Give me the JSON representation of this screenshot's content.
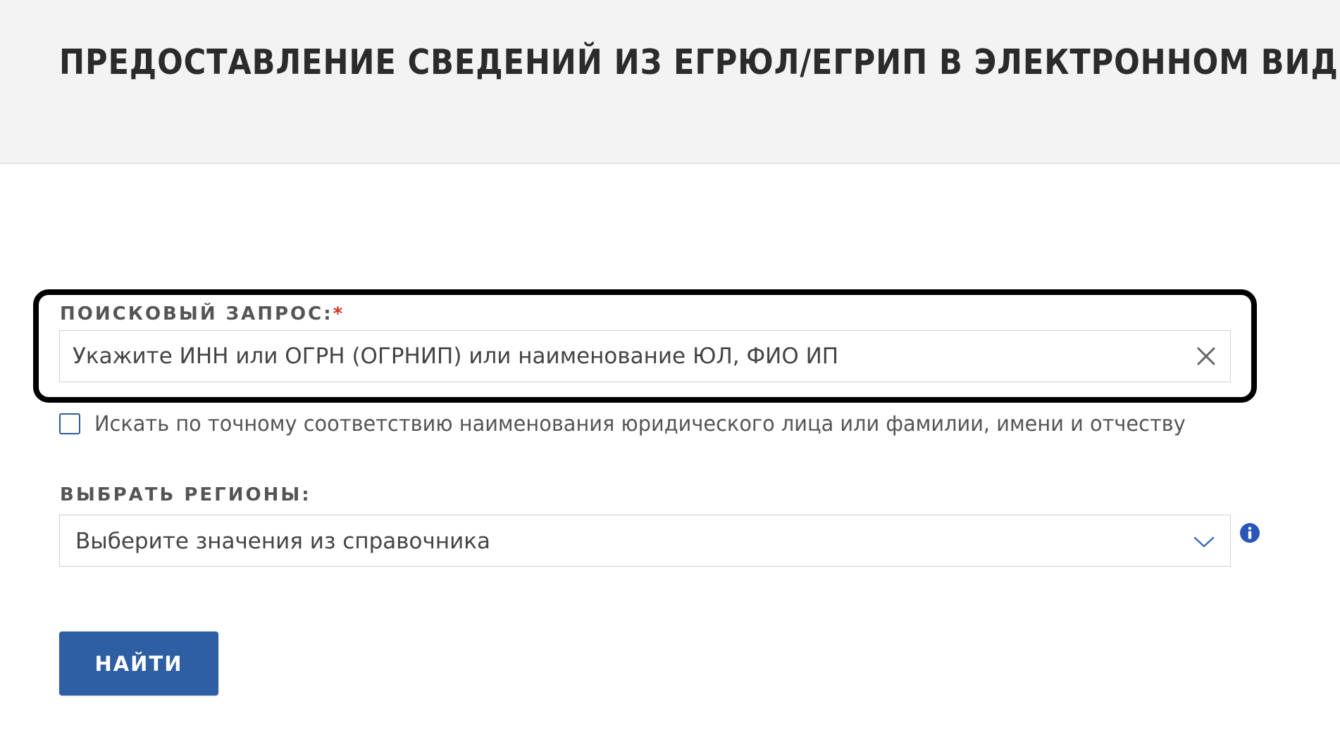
{
  "header": {
    "title": "ПРЕДОСТАВЛЕНИЕ СВЕДЕНИЙ ИЗ ЕГРЮЛ/ЕГРИП В ЭЛЕКТРОННОМ ВИДЕ"
  },
  "search": {
    "label": "ПОИСКОВЫЙ ЗАПРОС:",
    "required_mark": "*",
    "placeholder": "Укажите ИНН или ОГРН (ОГРНИП) или наименование ЮЛ, ФИО ИП",
    "value": "",
    "clear_icon": "close-icon"
  },
  "exact_match": {
    "label": "Искать по точному соответствию наименования юридического лица или фамилии, имени и отчеству",
    "checked": false
  },
  "regions": {
    "label": "ВЫБРАТЬ РЕГИОНЫ:",
    "placeholder": "Выберите значения из справочника",
    "dropdown_icon": "chevron-down-icon",
    "help_icon": "info-icon"
  },
  "actions": {
    "find_label": "НАЙТИ"
  },
  "colors": {
    "header_bg": "#f3f3f3",
    "accent": "#2f5fa3",
    "required": "#d0332b",
    "highlight_frame": "#000000",
    "info_icon": "#2a56b8"
  }
}
